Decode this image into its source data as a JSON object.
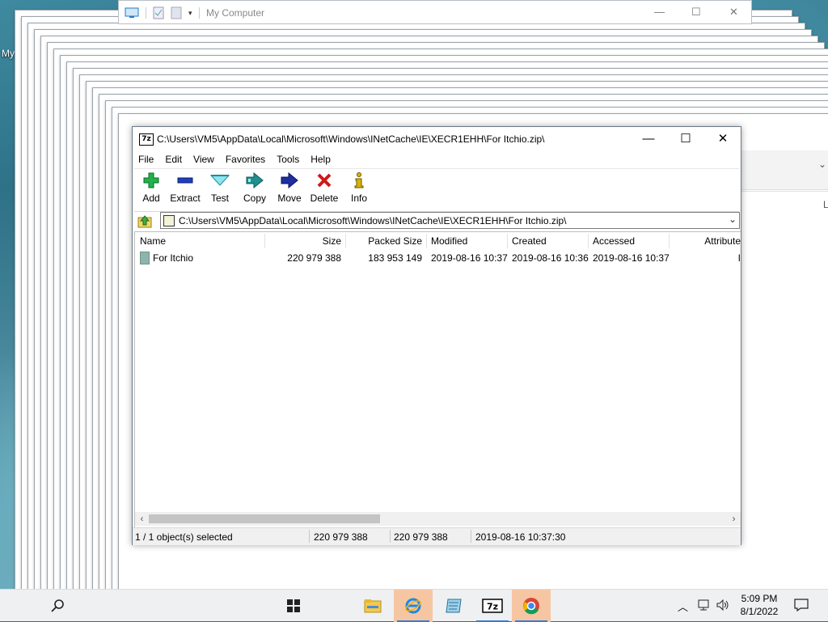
{
  "desktop": {
    "icon_label": "My"
  },
  "bg_window": {
    "title": "My Computer"
  },
  "window": {
    "title": "C:\\Users\\VM5\\AppData\\Local\\Microsoft\\Windows\\INetCache\\IE\\XECR1EHH\\For Itchio.zip\\",
    "app_icon_text": "7z",
    "minimize": "—",
    "maximize": "☐",
    "close": "✕"
  },
  "menu": [
    "File",
    "Edit",
    "View",
    "Favorites",
    "Tools",
    "Help"
  ],
  "toolbar": [
    {
      "label": "Add",
      "icon": "add-icon",
      "color": "#22b14c"
    },
    {
      "label": "Extract",
      "icon": "extract-icon",
      "color": "#1f3fbf"
    },
    {
      "label": "Test",
      "icon": "test-icon",
      "color": "#3ac4d6"
    },
    {
      "label": "Copy",
      "icon": "copy-icon",
      "color": "#1f8f8f"
    },
    {
      "label": "Move",
      "icon": "move-icon",
      "color": "#1f2f9f"
    },
    {
      "label": "Delete",
      "icon": "delete-icon",
      "color": "#d01818"
    },
    {
      "label": "Info",
      "icon": "info-icon",
      "color": "#d8b400"
    }
  ],
  "address": {
    "path": "C:\\Users\\VM5\\AppData\\Local\\Microsoft\\Windows\\INetCache\\IE\\XECR1EHH\\For Itchio.zip\\"
  },
  "columns": [
    "Name",
    "Size",
    "Packed Size",
    "Modified",
    "Created",
    "Accessed",
    "Attribute"
  ],
  "rows": [
    {
      "name": "For Itchio",
      "size": "220 979 388",
      "packed_size": "183 953 149",
      "modified": "2019-08-16 10:37",
      "created": "2019-08-16 10:36",
      "accessed": "2019-08-16 10:37",
      "attributes": "I"
    }
  ],
  "status": {
    "selected": "1 / 1 object(s) selected",
    "size": "220 979 388",
    "packed": "220 979 388",
    "date": "2019-08-16 10:37:30"
  },
  "taskbar": {
    "search_icon": "search-icon",
    "start_icon": "windows-start-icon",
    "apps": [
      "file-explorer-icon",
      "internet-explorer-icon",
      "notepad-icon",
      "7zip-icon",
      "chrome-icon"
    ],
    "time": "5:09 PM",
    "date": "8/1/2022"
  }
}
